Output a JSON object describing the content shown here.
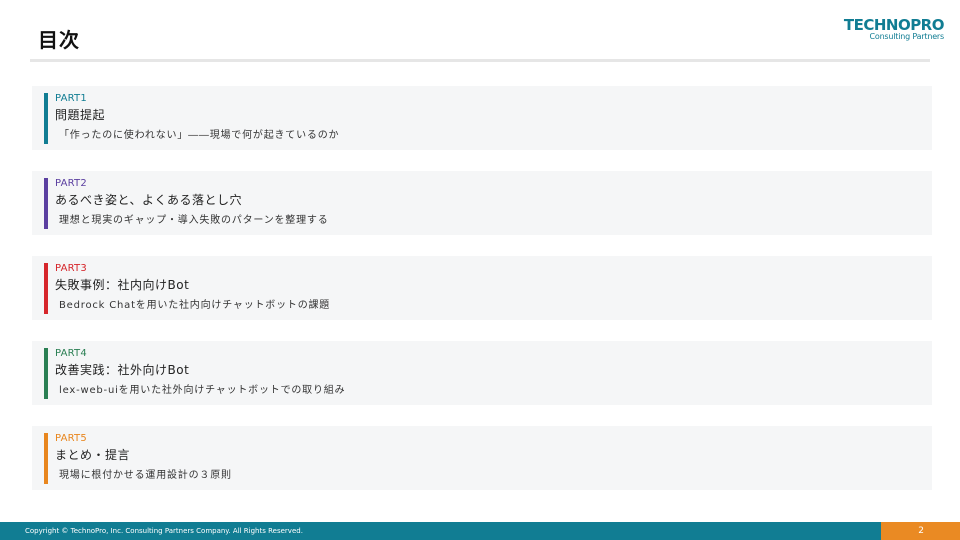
{
  "header": {
    "title": "目次",
    "logo_main": "TECHNOPRO",
    "logo_sub": "Consulting Partners"
  },
  "toc": {
    "items": [
      {
        "part": "PART1",
        "heading": "問題提起",
        "desc": "「作ったのに使われない」――現場で何が起きているのか",
        "color": "#117d93"
      },
      {
        "part": "PART2",
        "heading": "あるべき姿と、よくある落とし穴",
        "desc": "理想と現実のギャップ・導入失敗のパターンを整理する",
        "color": "#5b3fa0"
      },
      {
        "part": "PART3",
        "heading": "失敗事例：社内向けBot",
        "desc": "Bedrock Chatを用いた社内向けチャットボットの課題",
        "color": "#d6262b"
      },
      {
        "part": "PART4",
        "heading": "改善実践：社外向けBot",
        "desc": "lex-web-uiを用いた社外向けチャットボットでの取り組み",
        "color": "#2a7f53"
      },
      {
        "part": "PART5",
        "heading": "まとめ・提言",
        "desc": "現場に根付かせる運用設計の３原則",
        "color": "#e8861e"
      }
    ]
  },
  "footer": {
    "copyright": "Copyright © TechnoPro, Inc. Consulting Partners Company. All Rights Reserved.",
    "page_number": "2",
    "bar_color": "#117d93",
    "page_box_color": "#ea8a23"
  }
}
